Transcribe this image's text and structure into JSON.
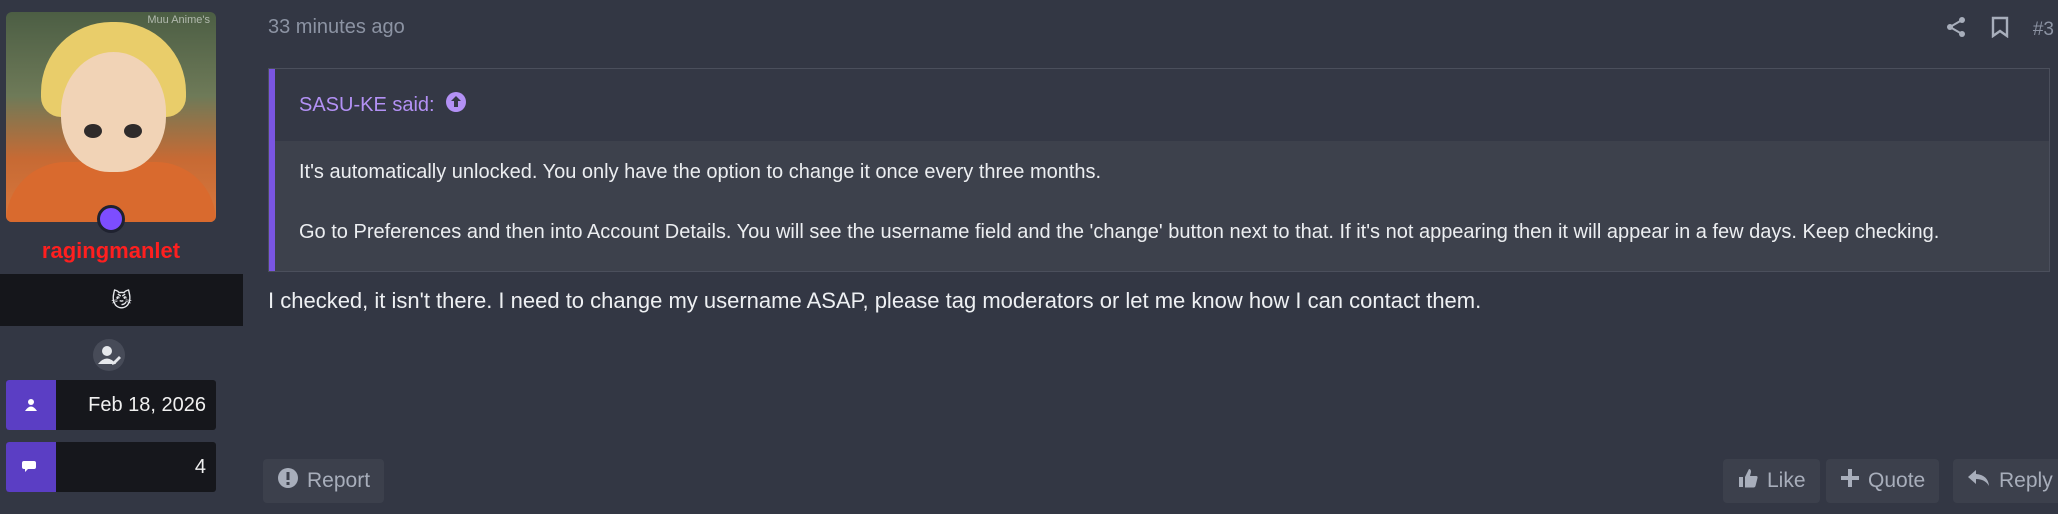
{
  "user": {
    "username": "ragingmanlet",
    "title_emoji": "😼",
    "joined": "Feb 18, 2026",
    "messages": "4",
    "avatar_watermark": "Muu Anime's"
  },
  "post": {
    "timestamp": "33 minutes ago",
    "post_number": "#3",
    "quote": {
      "author_said": "SASU-KE said:",
      "line1": "It's automatically unlocked. You only have the option to change it once every three months.",
      "line2": "Go to Preferences and then into Account Details. You will see the username field and the 'change' button next to that. If it's not appearing then it will appear in a few days. Keep checking."
    },
    "text": "I checked, it isn't there. I need to change my username ASAP, please tag moderators or let me know how I can contact them."
  },
  "actions": {
    "report": "Report",
    "like": "Like",
    "quote": "Quote",
    "reply": "Reply"
  },
  "colors": {
    "background": "#333744",
    "username": "#ff1f1f",
    "quote_accent": "#7a55e2",
    "quote_author": "#b391f5",
    "stat_icon_bg": "#5b3ec4"
  },
  "icons": [
    "share-icon",
    "bookmark-icon",
    "arrow-up-circle-icon",
    "user-edit-icon",
    "user-icon",
    "comments-icon",
    "exclamation-circle-icon",
    "thumbs-up-icon",
    "plus-icon",
    "reply-icon"
  ]
}
